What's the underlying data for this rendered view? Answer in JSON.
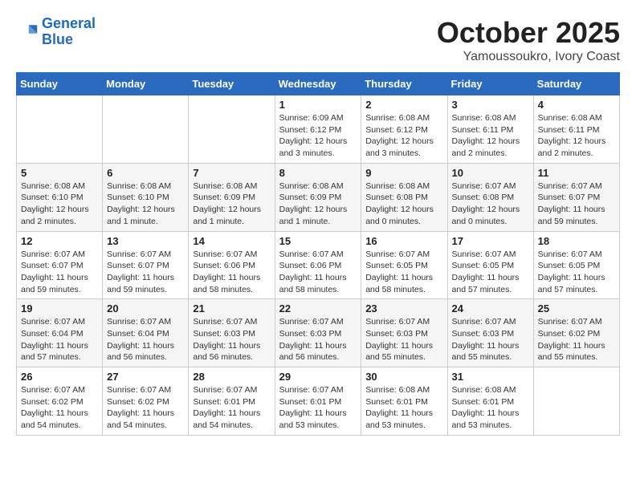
{
  "header": {
    "logo_line1": "General",
    "logo_line2": "Blue",
    "month_title": "October 2025",
    "location": "Yamoussoukro, Ivory Coast"
  },
  "weekdays": [
    "Sunday",
    "Monday",
    "Tuesday",
    "Wednesday",
    "Thursday",
    "Friday",
    "Saturday"
  ],
  "weeks": [
    [
      {
        "day": "",
        "info": ""
      },
      {
        "day": "",
        "info": ""
      },
      {
        "day": "",
        "info": ""
      },
      {
        "day": "1",
        "info": "Sunrise: 6:09 AM\nSunset: 6:12 PM\nDaylight: 12 hours\nand 3 minutes."
      },
      {
        "day": "2",
        "info": "Sunrise: 6:08 AM\nSunset: 6:12 PM\nDaylight: 12 hours\nand 3 minutes."
      },
      {
        "day": "3",
        "info": "Sunrise: 6:08 AM\nSunset: 6:11 PM\nDaylight: 12 hours\nand 2 minutes."
      },
      {
        "day": "4",
        "info": "Sunrise: 6:08 AM\nSunset: 6:11 PM\nDaylight: 12 hours\nand 2 minutes."
      }
    ],
    [
      {
        "day": "5",
        "info": "Sunrise: 6:08 AM\nSunset: 6:10 PM\nDaylight: 12 hours\nand 2 minutes."
      },
      {
        "day": "6",
        "info": "Sunrise: 6:08 AM\nSunset: 6:10 PM\nDaylight: 12 hours\nand 1 minute."
      },
      {
        "day": "7",
        "info": "Sunrise: 6:08 AM\nSunset: 6:09 PM\nDaylight: 12 hours\nand 1 minute."
      },
      {
        "day": "8",
        "info": "Sunrise: 6:08 AM\nSunset: 6:09 PM\nDaylight: 12 hours\nand 1 minute."
      },
      {
        "day": "9",
        "info": "Sunrise: 6:08 AM\nSunset: 6:08 PM\nDaylight: 12 hours\nand 0 minutes."
      },
      {
        "day": "10",
        "info": "Sunrise: 6:07 AM\nSunset: 6:08 PM\nDaylight: 12 hours\nand 0 minutes."
      },
      {
        "day": "11",
        "info": "Sunrise: 6:07 AM\nSunset: 6:07 PM\nDaylight: 11 hours\nand 59 minutes."
      }
    ],
    [
      {
        "day": "12",
        "info": "Sunrise: 6:07 AM\nSunset: 6:07 PM\nDaylight: 11 hours\nand 59 minutes."
      },
      {
        "day": "13",
        "info": "Sunrise: 6:07 AM\nSunset: 6:07 PM\nDaylight: 11 hours\nand 59 minutes."
      },
      {
        "day": "14",
        "info": "Sunrise: 6:07 AM\nSunset: 6:06 PM\nDaylight: 11 hours\nand 58 minutes."
      },
      {
        "day": "15",
        "info": "Sunrise: 6:07 AM\nSunset: 6:06 PM\nDaylight: 11 hours\nand 58 minutes."
      },
      {
        "day": "16",
        "info": "Sunrise: 6:07 AM\nSunset: 6:05 PM\nDaylight: 11 hours\nand 58 minutes."
      },
      {
        "day": "17",
        "info": "Sunrise: 6:07 AM\nSunset: 6:05 PM\nDaylight: 11 hours\nand 57 minutes."
      },
      {
        "day": "18",
        "info": "Sunrise: 6:07 AM\nSunset: 6:05 PM\nDaylight: 11 hours\nand 57 minutes."
      }
    ],
    [
      {
        "day": "19",
        "info": "Sunrise: 6:07 AM\nSunset: 6:04 PM\nDaylight: 11 hours\nand 57 minutes."
      },
      {
        "day": "20",
        "info": "Sunrise: 6:07 AM\nSunset: 6:04 PM\nDaylight: 11 hours\nand 56 minutes."
      },
      {
        "day": "21",
        "info": "Sunrise: 6:07 AM\nSunset: 6:03 PM\nDaylight: 11 hours\nand 56 minutes."
      },
      {
        "day": "22",
        "info": "Sunrise: 6:07 AM\nSunset: 6:03 PM\nDaylight: 11 hours\nand 56 minutes."
      },
      {
        "day": "23",
        "info": "Sunrise: 6:07 AM\nSunset: 6:03 PM\nDaylight: 11 hours\nand 55 minutes."
      },
      {
        "day": "24",
        "info": "Sunrise: 6:07 AM\nSunset: 6:03 PM\nDaylight: 11 hours\nand 55 minutes."
      },
      {
        "day": "25",
        "info": "Sunrise: 6:07 AM\nSunset: 6:02 PM\nDaylight: 11 hours\nand 55 minutes."
      }
    ],
    [
      {
        "day": "26",
        "info": "Sunrise: 6:07 AM\nSunset: 6:02 PM\nDaylight: 11 hours\nand 54 minutes."
      },
      {
        "day": "27",
        "info": "Sunrise: 6:07 AM\nSunset: 6:02 PM\nDaylight: 11 hours\nand 54 minutes."
      },
      {
        "day": "28",
        "info": "Sunrise: 6:07 AM\nSunset: 6:01 PM\nDaylight: 11 hours\nand 54 minutes."
      },
      {
        "day": "29",
        "info": "Sunrise: 6:07 AM\nSunset: 6:01 PM\nDaylight: 11 hours\nand 53 minutes."
      },
      {
        "day": "30",
        "info": "Sunrise: 6:08 AM\nSunset: 6:01 PM\nDaylight: 11 hours\nand 53 minutes."
      },
      {
        "day": "31",
        "info": "Sunrise: 6:08 AM\nSunset: 6:01 PM\nDaylight: 11 hours\nand 53 minutes."
      },
      {
        "day": "",
        "info": ""
      }
    ]
  ]
}
